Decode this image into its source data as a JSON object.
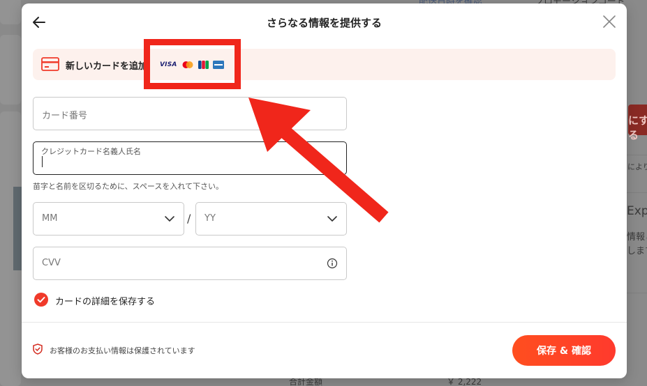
{
  "background": {
    "top_link": "配送日時を確認",
    "promo_code": "プロモーションコード",
    "side_button": "にする",
    "side_note": "により",
    "express_brand": "Expr",
    "info_line1": "情報と",
    "info_line2": "します",
    "total_label": "合計金額",
    "total_value": "￥ 2,222"
  },
  "modal": {
    "title": "さらなる情報を提供する",
    "new_card_label": "新しいカードを追加",
    "brands": [
      "VISA",
      "Mastercard",
      "JCB",
      "American Express"
    ],
    "fields": {
      "card_number_placeholder": "カード番号",
      "cardholder_label": "クレジットカード名義人氏名",
      "cardholder_hint": "苗字と名前を区切るために、スペースを入れて下さい。",
      "month_placeholder": "MM",
      "year_placeholder": "YY",
      "date_separator": "/",
      "cvv_placeholder": "CVV"
    },
    "save_details_label": "カードの詳細を保存する",
    "save_details_checked": true,
    "secure_note": "お客様のお支払い情報は保護されています",
    "submit_label": "保存 & 確認"
  },
  "colors": {
    "accent": "#ff4a23",
    "annotation": "#f0261b",
    "bar_bg": "#fdf1ed"
  }
}
